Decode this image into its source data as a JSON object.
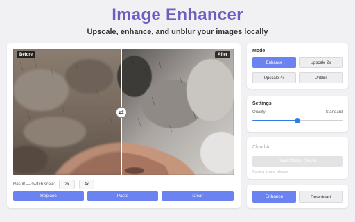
{
  "header": {
    "title": "Image Enhancer",
    "subtitle": "Upscale, enhance, and unblur your images locally"
  },
  "compare": {
    "before_label": "Before",
    "after_label": "After",
    "handle_glyph": "⇄"
  },
  "scale": {
    "label": "Result — switch scale:",
    "options": [
      "2x",
      "4x"
    ]
  },
  "actions": {
    "replace": "Replace",
    "paste": "Paste",
    "clear": "Clear"
  },
  "mode": {
    "title": "Mode",
    "options": [
      "Enhance",
      "Upscale 2x",
      "Upscale 4x",
      "Unblur"
    ],
    "selected": "Enhance"
  },
  "settings": {
    "title": "Settings",
    "quality_label": "Quality",
    "quality_value": "Standard",
    "slider_level": 0.5
  },
  "cloud": {
    "title": "Cloud AI",
    "button_label": "Save Models (Soon)",
    "note": "Coming in next release"
  },
  "footer_actions": {
    "enhance": "Enhance",
    "download": "Download"
  },
  "colors": {
    "accent": "#6b83f0",
    "title": "#6a5fc1",
    "slider": "#2f7ee8"
  }
}
